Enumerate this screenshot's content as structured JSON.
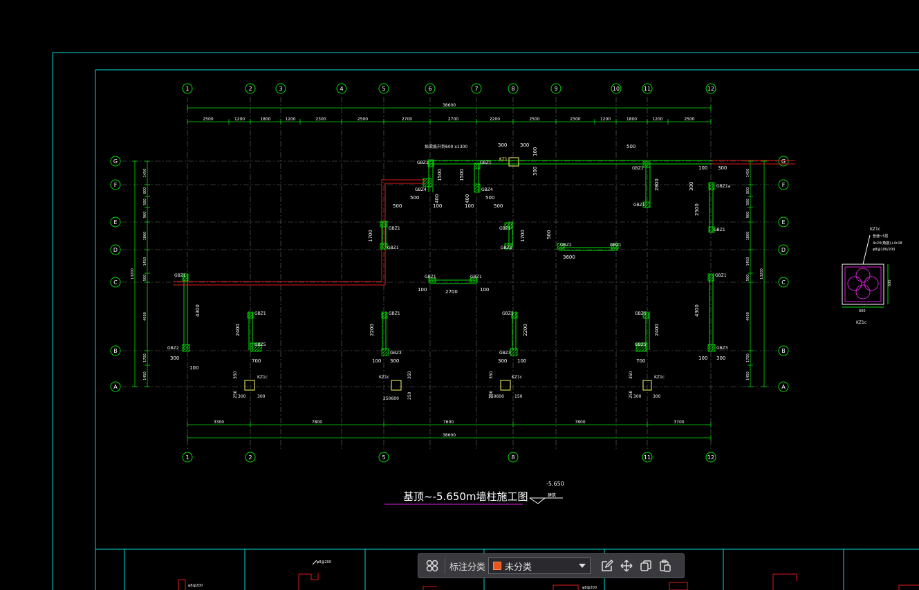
{
  "drawing": {
    "title": "基顶~-5.650m墙柱施工图",
    "elevation_mark": "-5.650",
    "elevation_sub": "建筑",
    "total_dim": "38600",
    "total_height": "13200",
    "tag_lintel": "抬梁底升到600 x1300",
    "detail_title": "KZ1c",
    "detail_note_1": "普通~5层",
    "detail_note_2": "4c20(角筋)+4c18",
    "detail_note_3": "φ8@100/200",
    "detail_dim_w": "600",
    "detail_dim_h": "600",
    "detail_label": "KZ1c",
    "col_axes_top": [
      "1",
      "2",
      "3",
      "4",
      "5",
      "6",
      "7",
      "8",
      "9",
      "10",
      "11",
      "12"
    ],
    "col_axes_bottom": [
      "1",
      "2",
      "5",
      "8",
      "11",
      "12"
    ],
    "row_axes": [
      "G",
      "F",
      "E",
      "D",
      "C",
      "B",
      "A"
    ],
    "top_dims": [
      "2500",
      "1200",
      "1800",
      "1200",
      "2300",
      "2500",
      "2700",
      "2700",
      "2200",
      "2500",
      "2300",
      "1200",
      "1800",
      "1200",
      "2500"
    ],
    "bottom_dims": [
      "3300",
      "7800",
      "7600",
      "7800",
      "3700"
    ],
    "left_dims": [
      "1450",
      "800",
      "500",
      "900",
      "1800",
      "1450",
      "500",
      "4000",
      "1700",
      "1450"
    ],
    "labels": {
      "gbz1": "GBZ1",
      "gbz2": "GBZ2",
      "gbz3": "GBZ3",
      "gbz4": "GBZ4",
      "gbz5": "GBZ5",
      "gbz1a": "GBZ1a",
      "kz1": "KZ1",
      "kz1c": "KZ1c",
      "d300": "300",
      "d500": "500",
      "d100": "100",
      "d150": "150",
      "d250": "250",
      "d350": "350",
      "d400": "400",
      "d600": "600",
      "d700": "700",
      "d1500": "1500",
      "d1700": "1700",
      "d2200": "2200",
      "d2400": "2400",
      "d2500": "2500",
      "d2700": "2700",
      "d2800": "2800",
      "d3600": "3600",
      "d4300": "4300",
      "d250600": "250600",
      "d150600": "150600"
    },
    "titleblock_labels": [
      "φ8@200",
      "φ8@200",
      "φ8@200"
    ]
  },
  "toolbar": {
    "category_label": "标注分类",
    "selected_category": "未分类",
    "swatch_color": "#e8541a"
  }
}
